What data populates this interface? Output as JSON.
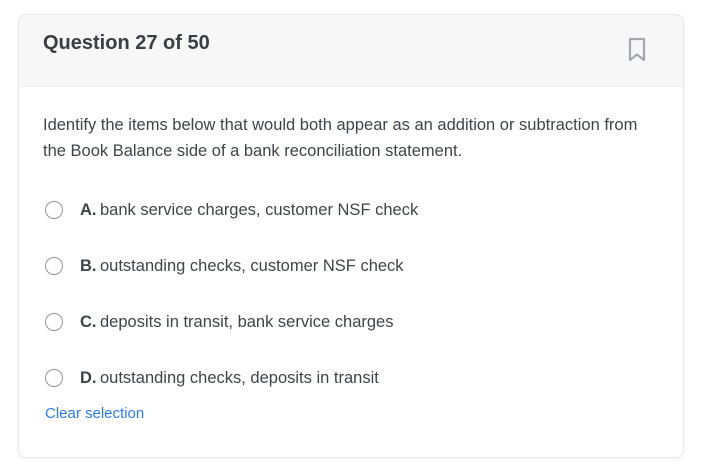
{
  "header": {
    "title": "Question 27 of 50",
    "bookmark_icon": "bookmark-icon"
  },
  "question": {
    "text": "Identify the items below that would both appear as an addition or subtraction from the Book Balance side of a bank reconciliation statement."
  },
  "options": [
    {
      "letter": "A.",
      "text": "bank service charges, customer NSF check",
      "selected": false
    },
    {
      "letter": "B.",
      "text": "outstanding checks, customer NSF check",
      "selected": false
    },
    {
      "letter": "C.",
      "text": "deposits in transit, bank service charges",
      "selected": false
    },
    {
      "letter": "D.",
      "text": "outstanding checks, deposits in transit",
      "selected": false
    }
  ],
  "actions": {
    "clear_label": "Clear selection"
  },
  "colors": {
    "link": "#2c7be5",
    "header_bg": "#f7f7f8",
    "text": "#3f434a"
  }
}
